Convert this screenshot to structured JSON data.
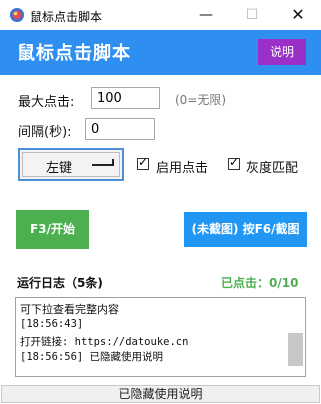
{
  "window": {
    "title": "鼠标点击脚本",
    "minimize_glyph": "—",
    "maximize_glyph": "☐",
    "close_glyph": "✕"
  },
  "header": {
    "title": "鼠标点击脚本",
    "help_label": "说明",
    "color": "#2e8ff0",
    "help_color": "#9b30c8"
  },
  "form": {
    "max_clicks_label": "最大点击:",
    "max_clicks_value": "100",
    "max_clicks_hint": "(0=无限)",
    "interval_label": "间隔(秒):",
    "interval_value": "0"
  },
  "mouse_button": {
    "selected": "左键"
  },
  "checkboxes": [
    {
      "label": "启用点击",
      "checked": true
    },
    {
      "label": "灰度匹配",
      "checked": true
    }
  ],
  "buttons": {
    "start_label": "F3/开始",
    "screenshot_label": "(未截图) 按F6/截图",
    "start_color": "#4caf50",
    "screenshot_color": "#2196f3"
  },
  "log": {
    "title": "运行日志（5条)",
    "clicked": "已点击：0/10",
    "lines": [
      "可下拉查看完整内容",
      "[18:56:43]",
      "打开链接: https://datouke.cn",
      "[18:56:56] 已隐藏使用说明"
    ]
  },
  "status_bar": "已隐藏使用说明"
}
